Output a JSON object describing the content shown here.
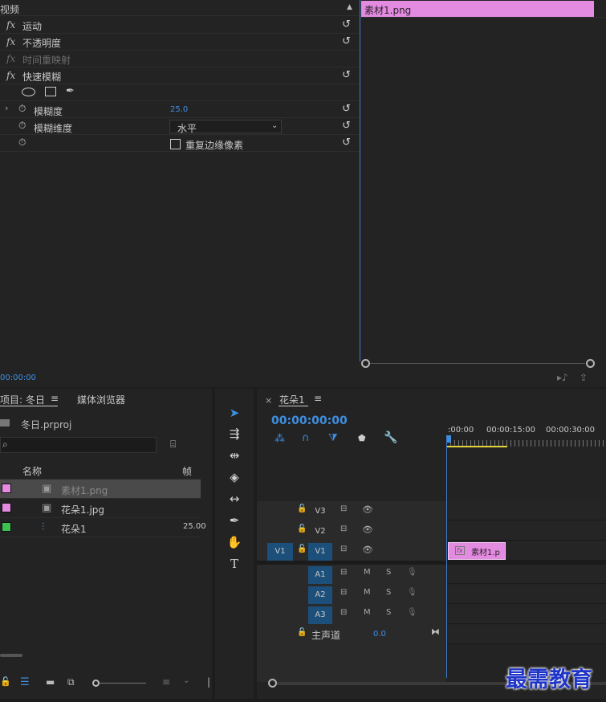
{
  "effects": {
    "section_title": "视频",
    "rows": [
      {
        "label": "运动",
        "fx": "fx",
        "dim": false
      },
      {
        "label": "不透明度",
        "fx": "fx",
        "dim": false
      },
      {
        "label": "时间重映射",
        "fx": "fx",
        "dim": true
      },
      {
        "label": "快速模糊",
        "fx": "fx",
        "dim": false
      }
    ],
    "blur_amount_label": "模糊度",
    "blur_amount_value": "25.0",
    "blur_dim_label": "模糊维度",
    "blur_dim_value": "水平",
    "repeat_edge_label": "重复边缘像素",
    "clip_name": "素材1.png",
    "timecode": "00:00:00"
  },
  "project": {
    "tab_project": "项目: 冬日",
    "tab_media": "媒体浏览器",
    "project_file": "冬日.prproj",
    "search_placeholder": "",
    "col_name": "名称",
    "col_rate": "帧速",
    "items": [
      {
        "name": "素材1.png",
        "color": "#e38be0",
        "rate": "",
        "selected": true
      },
      {
        "name": "花朵1.jpg",
        "color": "#e38be0",
        "rate": "",
        "selected": false
      },
      {
        "name": "花朵1",
        "color": "#3fbf4f",
        "rate": "25.00",
        "selected": false
      }
    ]
  },
  "timeline": {
    "tab_label": "花朵1",
    "timecode": "00:00:00:00",
    "ruler": [
      ":00:00",
      "00:00:15:00",
      "00:00:30:00"
    ],
    "video_tracks": [
      "V3",
      "V2",
      "V1"
    ],
    "audio_tracks": [
      "A1",
      "A2",
      "A3"
    ],
    "source_patch": "V1",
    "master_label": "主声道",
    "master_value": "0.0",
    "clip_label": "素材1.p",
    "mute": "M",
    "solo": "S"
  },
  "watermark": "最需教育",
  "colors": {
    "accent_blue": "#3f7cc8",
    "clip_pink": "#e38be0",
    "seq_green": "#3fbf4f"
  }
}
